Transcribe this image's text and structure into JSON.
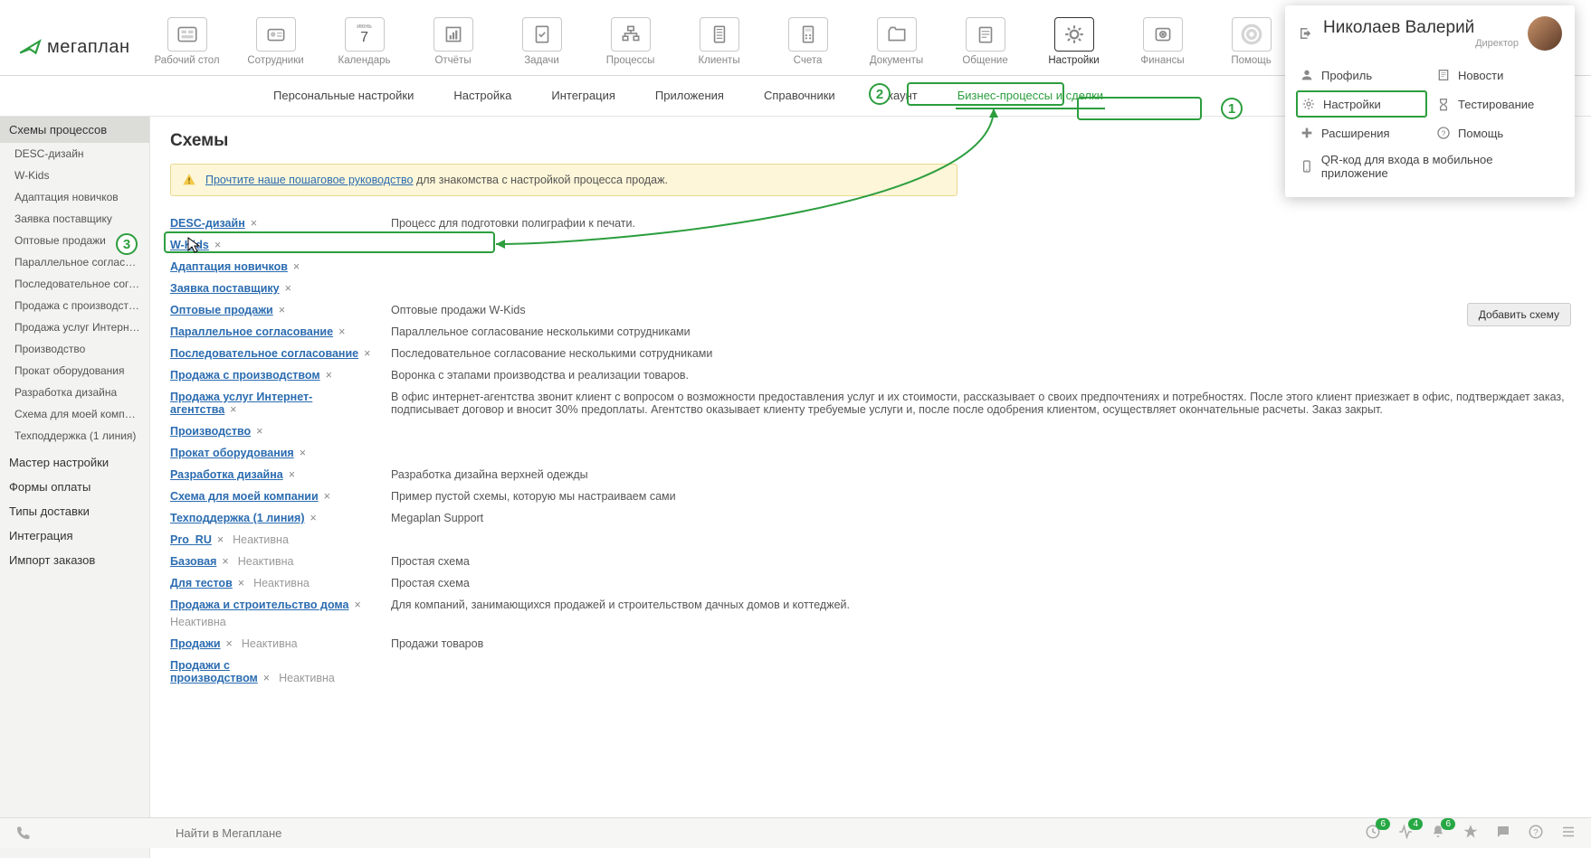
{
  "logo_text": "мегаплан",
  "topnav": [
    {
      "label": "Рабочий стол"
    },
    {
      "label": "Сотрудники"
    },
    {
      "label": "Календарь",
      "sub": "июнь",
      "day": "7"
    },
    {
      "label": "Отчёты"
    },
    {
      "label": "Задачи"
    },
    {
      "label": "Процессы"
    },
    {
      "label": "Клиенты"
    },
    {
      "label": "Счета"
    },
    {
      "label": "Документы"
    },
    {
      "label": "Общение"
    },
    {
      "label": "Настройки",
      "active": true
    },
    {
      "label": "Финансы"
    },
    {
      "label": "Помощь"
    }
  ],
  "subnav": [
    "Персональные настройки",
    "Настройка",
    "Интеграция",
    "Приложения",
    "Справочники",
    "Аккаунт",
    "Бизнес-процессы и сделки"
  ],
  "subnav_active_index": 6,
  "sidebar": {
    "group_header": "Схемы процессов",
    "schemes": [
      "DESC-дизайн",
      "W-Kids",
      "Адаптация новичков",
      "Заявка поставщику",
      "Оптовые продажи",
      "Параллельное согласование",
      "Последовательное согласов...",
      "Продажа с производством",
      "Продажа услуг Интернет-аге...",
      "Производство",
      "Прокат оборудования",
      "Разработка дизайна",
      "Схема для моей компании",
      "Техподдержка (1 линия)"
    ],
    "bottom": [
      "Мастер настройки",
      "Формы оплаты",
      "Типы доставки",
      "Интеграция",
      "Импорт заказов"
    ]
  },
  "page_title": "Схемы",
  "info_text_pre": "Прочтите наше пошаговое руководство",
  "info_text_post": " для знакомства с настройкой процесса продаж.",
  "add_button": "Добавить схему",
  "schemes": [
    {
      "name": "DESC-дизайн",
      "desc": "Процесс для подготовки полиграфии к печати."
    },
    {
      "name": "W-Kids",
      "desc": "",
      "highlight": true
    },
    {
      "name": "Адаптация новичков",
      "desc": ""
    },
    {
      "name": "Заявка поставщику",
      "desc": ""
    },
    {
      "name": "Оптовые продажи",
      "desc": "Оптовые продажи W-Kids"
    },
    {
      "name": "Параллельное согласование",
      "desc": "Параллельное согласование несколькими сотрудниками"
    },
    {
      "name": "Последовательное согласование",
      "desc": "Последовательное согласование несколькими сотрудниками"
    },
    {
      "name": "Продажа с производством",
      "desc": "Воронка с этапами производства и реализации товаров."
    },
    {
      "name": "Продажа услуг Интернет-агентства",
      "desc": "В офис интернет-агентства звонит клиент с вопросом о возможности предоставления услуг и их стоимости, рассказывает о своих предпочтениях и потребностях. После этого клиент приезжает в офис, подтверждает заказ, подписывает договор и вносит 30% предоплаты. Агентство оказывает клиенту требуемые услуги и, после после одобрения клиентом, осуществляет окончательные расчеты. Заказ закрыт."
    },
    {
      "name": "Производство",
      "desc": ""
    },
    {
      "name": "Прокат оборудования",
      "desc": ""
    },
    {
      "name": "Разработка дизайна",
      "desc": "Разработка дизайна верхней одежды"
    },
    {
      "name": "Схема для моей компании",
      "desc": "Пример пустой схемы, которую мы настраиваем сами"
    },
    {
      "name": "Техподдержка (1 линия)",
      "desc": "Megaplan Support"
    },
    {
      "name": "Pro_RU",
      "desc": "",
      "inactive": true
    },
    {
      "name": "Базовая",
      "desc": "Простая схема",
      "inactive": true
    },
    {
      "name": "Для тестов",
      "desc": "Простая схема",
      "inactive": true
    },
    {
      "name": "Продажа и строительство дома",
      "desc": "Для компаний, занимающихся продажей и строительством дачных домов и коттеджей.",
      "inactive": true,
      "inactive_below": true
    },
    {
      "name": "Продажи",
      "desc": "Продажи товаров",
      "inactive": true
    },
    {
      "name": "Продажи с производством",
      "desc": "",
      "inactive": true,
      "cut": true
    }
  ],
  "inactive_label": "Неактивна",
  "user": {
    "name": "Николаев Валерий",
    "role": "Директор",
    "items_left": [
      "Профиль",
      "Настройки",
      "Расширения"
    ],
    "items_right": [
      "Новости",
      "Тестирование",
      "Помощь"
    ],
    "qr": "QR-код для входа в мобильное приложение"
  },
  "callout_nums": {
    "c1": "1",
    "c2": "2",
    "c3": "3"
  },
  "search_placeholder": "Найти в Мегаплане",
  "badges": {
    "a": "6",
    "b": "4",
    "c": "6"
  }
}
